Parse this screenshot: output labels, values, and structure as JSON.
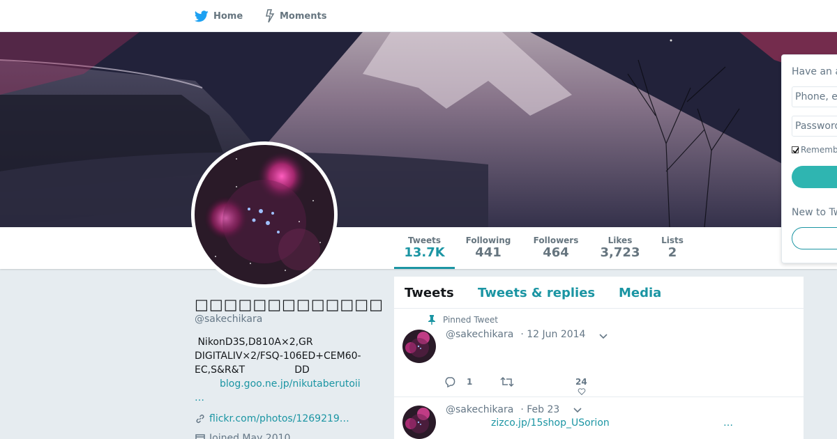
{
  "nav": {
    "home_label": "Home",
    "moments_label": "Moments"
  },
  "stats": [
    {
      "label": "Tweets",
      "value": "13.7K"
    },
    {
      "label": "Following",
      "value": "441"
    },
    {
      "label": "Followers",
      "value": "464"
    },
    {
      "label": "Likes",
      "value": "3,723"
    },
    {
      "label": "Lists",
      "value": "2"
    }
  ],
  "profile": {
    "name": "□□□□□□□□□□□□□",
    "handle": "@sakechikara",
    "bio_line1": " NikonD3S,D810A×2,GR",
    "bio_line2": "DIGITALIV×2/FSQ-106ED+CEM60-",
    "bio_line3": "EC,S&R&T                DD",
    "bio_link": "blog.goo.ne.jp/nikutaberutoii",
    "bio_more": "…",
    "website": "flickr.com/photos/1269219…",
    "joined": "Joined May 2010"
  },
  "timeline": {
    "tabs": [
      "Tweets",
      "Tweets & replies",
      "Media"
    ],
    "tweets": [
      {
        "pinned_label": "Pinned Tweet",
        "handle": "@sakechikara",
        "date": "· 12 Jun 2014",
        "reply_count": "1",
        "like_count": "24"
      },
      {
        "handle": "@sakechikara",
        "date": "· Feb 23",
        "link": "zizco.jp/15shop_USorion",
        "more": "…"
      }
    ]
  },
  "login": {
    "title": "Have an account?",
    "phone_placeholder": "Phone, email or username",
    "password_placeholder": "Password",
    "remember_label": "Remember me",
    "new_to": "New to Twitter?"
  },
  "colors": {
    "accent": "#1b95a3",
    "twitter_blue": "#1da1f2",
    "background": "#e6ecf0"
  }
}
